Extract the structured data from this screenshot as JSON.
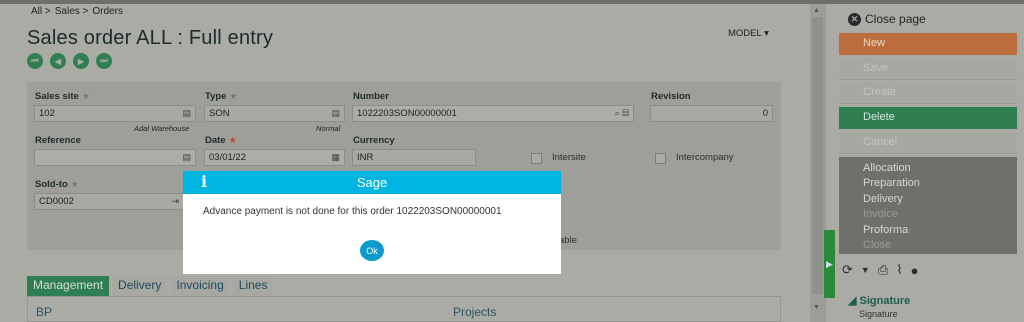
{
  "breadcrumb": {
    "all": "All >",
    "sales": "Sales >",
    "orders": "Orders"
  },
  "page": {
    "title": "Sales order ALL : Full entry",
    "model": "MODEL ▾"
  },
  "nav": {
    "first": "⏮",
    "prev": "◀",
    "next": "▶",
    "last": "⏭"
  },
  "form": {
    "sales_site": {
      "label": "Sales site",
      "value": "102",
      "sub": "Adal Warehouse"
    },
    "type": {
      "label": "Type",
      "value": "SON",
      "sub": "Normal"
    },
    "number": {
      "label": "Number",
      "value": "1022203SON00000001"
    },
    "revision": {
      "label": "Revision",
      "value": "0"
    },
    "reference": {
      "label": "Reference",
      "value": ""
    },
    "date": {
      "label": "Date",
      "value": "03/01/22"
    },
    "currency": {
      "label": "Currency",
      "value": "INR"
    },
    "intersite": {
      "label": "Intersite"
    },
    "intercompany": {
      "label": "Intercompany"
    },
    "sold_to": {
      "label": "Sold-to",
      "value": "CD0002"
    },
    "partial_label": "able"
  },
  "tabs": [
    "Management",
    "Delivery",
    "Invoicing",
    "Lines"
  ],
  "panel": {
    "left": "BP",
    "right": "Projects"
  },
  "side": {
    "close": "Close page",
    "new": "New",
    "save": "Save",
    "create": "Create",
    "delete": "Delete",
    "cancel": "Cancel",
    "group": [
      "Allocation",
      "Preparation",
      "Delivery",
      "Invoice",
      "Proforma",
      "Close"
    ],
    "signature_head": "Signature",
    "signature_sub": "Signature"
  },
  "modal": {
    "title": "Sage",
    "message": "Advance payment is not done for this order 1022203SON00000001",
    "ok": "Ok"
  },
  "colors": {
    "accent_green": "#2f7f52",
    "new_orange": "#bb6e3b",
    "modal_header": "#00b5e2"
  }
}
